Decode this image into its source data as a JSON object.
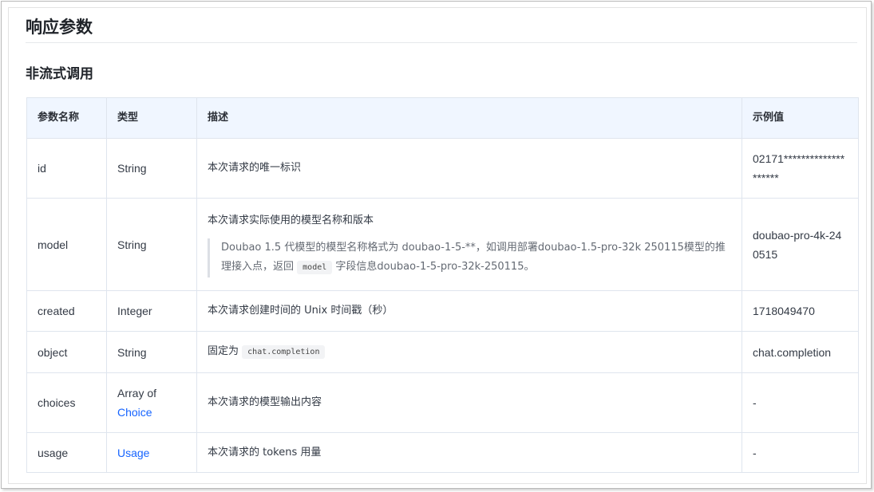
{
  "section_title": "响应参数",
  "subsection_title": "非流式调用",
  "table": {
    "headers": [
      "参数名称",
      "类型",
      "描述",
      "示例值"
    ],
    "rows": [
      {
        "name": "id",
        "type": "String",
        "type_link": false,
        "desc": "本次请求的唯一标识",
        "example": "02171********************"
      },
      {
        "name": "model",
        "type": "String",
        "type_link": false,
        "desc": "本次请求实际使用的模型名称和版本",
        "note_pre": "Doubao 1.5 代模型的模型名称格式为 doubao-1-5-**，如调用部署doubao-1.5-pro-32k 250115模型的推理接入点，返回",
        "note_code": "model",
        "note_post": "字段信息doubao-1-5-pro-32k-250115。",
        "example": "doubao-pro-4k-240515"
      },
      {
        "name": "created",
        "type": "Integer",
        "type_link": false,
        "desc": "本次请求创建时间的 Unix 时间戳（秒）",
        "example": "1718049470"
      },
      {
        "name": "object",
        "type": "String",
        "type_link": false,
        "desc_pre": "固定为",
        "desc_code": "chat.completion",
        "example": "chat.completion"
      },
      {
        "name": "choices",
        "type_prefix": "Array of",
        "type": "Choice",
        "type_link": true,
        "desc": "本次请求的模型输出内容",
        "example": "-"
      },
      {
        "name": "usage",
        "type": "Usage",
        "type_link": true,
        "desc": "本次请求的 tokens 用量",
        "example": "-"
      }
    ]
  },
  "colors": {
    "link": "#1664ff",
    "header_bg": "#f0f6ff",
    "border": "#dfe5ee"
  }
}
